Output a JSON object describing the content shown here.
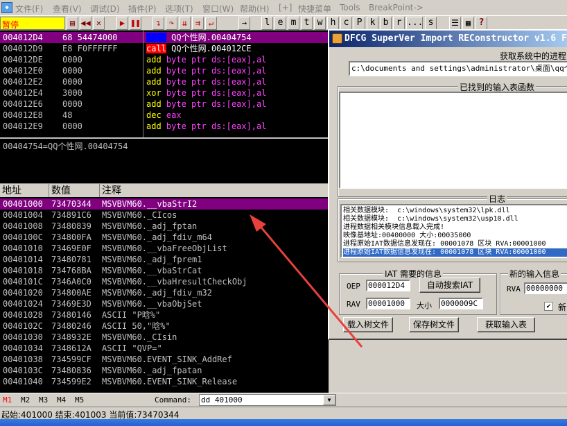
{
  "menu": {
    "items": [
      "文件(F)",
      "查看(V)",
      "调试(D)",
      "插件(P)",
      "选项(T)",
      "窗口(W)",
      "帮助(H)",
      "[+]",
      "快捷菜单",
      "Tools",
      "BreakPoint->"
    ]
  },
  "toolbar": {
    "status": "暂停",
    "letters": [
      "l",
      "e",
      "m",
      "t",
      "w",
      "h",
      "c",
      "P",
      "k",
      "b",
      "r",
      "...",
      "s",
      "?"
    ]
  },
  "disasm": {
    "rows": [
      {
        "addr": "004012D4",
        "hex": "68 54474000",
        "op": "push",
        "args": "QQ个性网.00404754",
        "op_color": "#0000ff",
        "sel": true
      },
      {
        "addr": "004012D9",
        "hex": "E8 F0FFFFFF",
        "op": "call",
        "args": "QQ个性网.004012CE",
        "op_color": "#ff0000",
        "sel": false
      },
      {
        "addr": "004012DE",
        "hex": "0000",
        "op": "add",
        "args": "byte ptr ds:[eax],al",
        "op_color": "#ffff00",
        "sel": false
      },
      {
        "addr": "004012E0",
        "hex": "0000",
        "op": "add",
        "args": "byte ptr ds:[eax],al",
        "op_color": "#ffff00",
        "sel": false
      },
      {
        "addr": "004012E2",
        "hex": "0000",
        "op": "add",
        "args": "byte ptr ds:[eax],al",
        "op_color": "#ffff00",
        "sel": false
      },
      {
        "addr": "004012E4",
        "hex": "3000",
        "op": "xor",
        "args": "byte ptr ds:[eax],al",
        "op_color": "#ffff00",
        "sel": false
      },
      {
        "addr": "004012E6",
        "hex": "0000",
        "op": "add",
        "args": "byte ptr ds:[eax],al",
        "op_color": "#ffff00",
        "sel": false
      },
      {
        "addr": "004012E8",
        "hex": "48",
        "op": "dec",
        "args": "eax",
        "op_color": "#ffff00",
        "sel": false
      },
      {
        "addr": "004012E9",
        "hex": "0000",
        "op": "add",
        "args": "byte ptr ds:[eax],al",
        "op_color": "#ffff00",
        "sel": false
      }
    ]
  },
  "info": {
    "text": "00404754=QQ个性网.00404754"
  },
  "dump": {
    "headers": [
      "地址",
      "数值",
      "注释"
    ],
    "rows": [
      {
        "addr": "00401000",
        "val": "73470344",
        "comment": "MSVBVM60.__vbaStrI2",
        "sel": true
      },
      {
        "addr": "00401004",
        "val": "734891C6",
        "comment": "MSVBVM60._CIcos",
        "sel": false
      },
      {
        "addr": "00401008",
        "val": "73480839",
        "comment": "MSVBVM60._adj_fptan",
        "sel": false
      },
      {
        "addr": "0040100C",
        "val": "734800FA",
        "comment": "MSVBVM60._adj_fdiv_m64",
        "sel": false
      },
      {
        "addr": "00401010",
        "val": "73469E0F",
        "comment": "MSVBVM60.__vbaFreeObjList",
        "sel": false
      },
      {
        "addr": "00401014",
        "val": "73480781",
        "comment": "MSVBVM60._adj_fprem1",
        "sel": false
      },
      {
        "addr": "00401018",
        "val": "734768BA",
        "comment": "MSVBVM60.__vbaStrCat",
        "sel": false
      },
      {
        "addr": "0040101C",
        "val": "7346A0C0",
        "comment": "MSVBVM60.__vbaHresultCheckObj",
        "sel": false
      },
      {
        "addr": "00401020",
        "val": "734800AE",
        "comment": "MSVBVM60._adj_fdiv_m32",
        "sel": false
      },
      {
        "addr": "00401024",
        "val": "73469E3D",
        "comment": "MSVBVM60.__vbaObjSet",
        "sel": false
      },
      {
        "addr": "00401028",
        "val": "73480146",
        "comment": "ASCII \"P晗%\"",
        "sel": false
      },
      {
        "addr": "0040102C",
        "val": "73480246",
        "comment": "ASCII 50,\"晗%\"",
        "sel": false
      },
      {
        "addr": "00401030",
        "val": "7348932E",
        "comment": "MSVBVM60._CIsin",
        "sel": false
      },
      {
        "addr": "00401034",
        "val": "7348612A",
        "comment": "ASCII \"QVP=\"",
        "sel": false
      },
      {
        "addr": "00401038",
        "val": "734599CF",
        "comment": "MSVBVM60.EVENT_SINK_AddRef",
        "sel": false
      },
      {
        "addr": "0040103C",
        "val": "73480836",
        "comment": "MSVBVM60._adj_fpatan",
        "sel": false
      },
      {
        "addr": "00401040",
        "val": "734599E2",
        "comment": "MSVBVM60.EVENT_SINK_Release",
        "sel": false
      }
    ]
  },
  "cmdbar": {
    "tabs": [
      "M1",
      "M2",
      "M3",
      "M4",
      "M5"
    ],
    "command_label": "Command:",
    "command_value": "dd 401000"
  },
  "statusbar": {
    "text": "起始:401000 结束:401003 当前值:73470344"
  },
  "importrec": {
    "title": "DFCG SuperVer Import REConstructor v1.6 F",
    "process_label": "获取系统中的进程",
    "process_value": "c:\\documents and settings\\administrator\\桌面\\qq个性网",
    "imports_label": "已找到的输入表函数",
    "log_label": "日志",
    "log_lines": [
      {
        "text": "相关数据模块:  c:\\windows\\system32\\lpk.dll",
        "sel": false
      },
      {
        "text": "相关数据模块:  c:\\windows\\system32\\usp10.dll",
        "sel": false
      },
      {
        "text": "进程数据相关模块信息载入完成!",
        "sel": false
      },
      {
        "text": "映像基地址:00400000 大小:00035000",
        "sel": false
      },
      {
        "text": "进程原始IAT数据信息发现在: 00001078 区块 RVA:00001000",
        "sel": false
      },
      {
        "text": "进程原始IAT数据信息发现在: 00001078 区块 RVA:00001000",
        "sel": true
      }
    ],
    "iat_label": "IAT 需要的信息",
    "oep_label": "OEP",
    "oep_value": "000012D4",
    "auto_iat_button": "自动搜索IAT",
    "rva_label": "RAV",
    "rva_value": "00001000",
    "size_label": "大小",
    "size_value": "0000009C",
    "new_import_label": "新的输入信息",
    "new_rva_label": "RVA",
    "new_rva_value": "00000000",
    "new_check_label": "新",
    "load_tree_button": "载入树文件",
    "save_tree_button": "保存树文件",
    "get_imports_button": "获取输入表"
  },
  "colors": {
    "selection": "#800080",
    "arrow": "#e8413c"
  }
}
